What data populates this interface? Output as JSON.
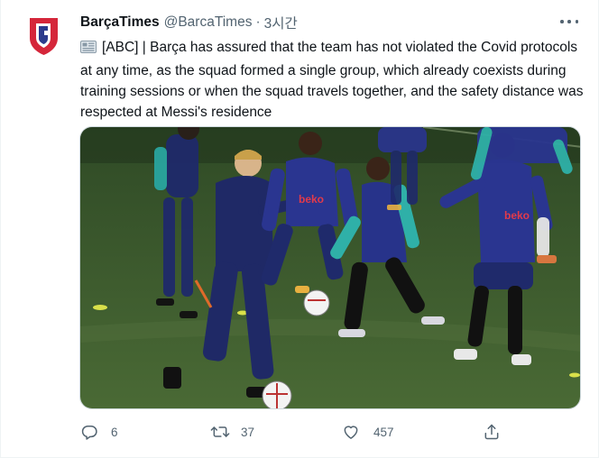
{
  "author": {
    "name": "BarçaTimes",
    "handle": "@BarcaTimes",
    "separator": "·",
    "time": "3시간"
  },
  "tweet": {
    "text": "[ABC] | Barça has assured that the team has not violated the Covid protocols at any time, as the squad formed a single group, which already coexists during training sessions or when the squad travels together, and the safety distance was respected at Messi's residence",
    "lead_icon": "newspaper-icon"
  },
  "media": {
    "sponsor_text": "beko"
  },
  "actions": {
    "reply_count": "6",
    "retweet_count": "37",
    "like_count": "457"
  },
  "colors": {
    "text_primary": "#0f1419",
    "text_secondary": "#536471",
    "brand_red": "#d5263a",
    "brand_blue": "#2b3a8c",
    "pitch": "#3c5a2c"
  }
}
